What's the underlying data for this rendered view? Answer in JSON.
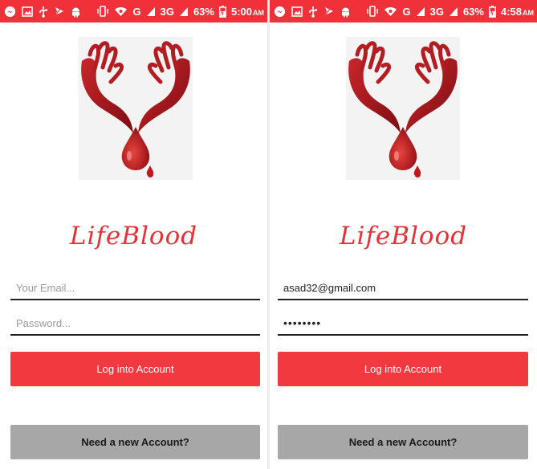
{
  "colors": {
    "brand_red": "#f2393f",
    "status_red": "#f0313a",
    "title_red": "#e53238",
    "secondary_gray": "#a7a7a7"
  },
  "screens": [
    {
      "status": {
        "battery": "63%",
        "network": "G",
        "network_3g": "3G",
        "time": "5:00",
        "ampm": "AM"
      },
      "app_title": "LifeBlood",
      "email": {
        "value": "",
        "placeholder": "Your Email..."
      },
      "password": {
        "value": "",
        "placeholder": "Password..."
      },
      "login_label": "Log into Account",
      "new_account_label": "Need a new Account?"
    },
    {
      "status": {
        "battery": "63%",
        "network": "G",
        "network_3g": "3G",
        "time": "4:58",
        "ampm": "AM"
      },
      "app_title": "LifeBlood",
      "email": {
        "value": "asad32@gmail.com",
        "placeholder": "Your Email..."
      },
      "password": {
        "value": "••••••••",
        "placeholder": "Password..."
      },
      "login_label": "Log into Account",
      "new_account_label": "Need a new Account?"
    }
  ],
  "icons": [
    "messenger-icon",
    "gallery-icon",
    "usb-icon",
    "send-icon",
    "android-icon",
    "vibrate-icon",
    "wifi-icon",
    "signal-icon",
    "battery-icon",
    "logo-hands-drop-icon"
  ]
}
